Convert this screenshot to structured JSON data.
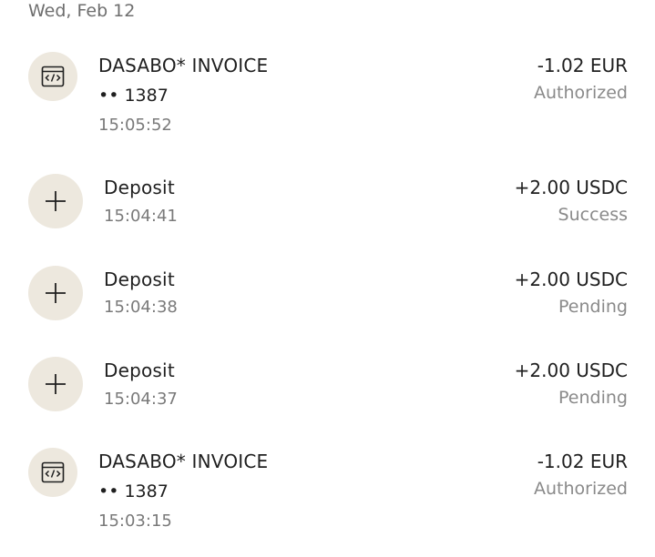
{
  "date_header": "Wed, Feb 12",
  "transactions": [
    {
      "icon": "card-code-icon",
      "title": "DASABO* INVOICE",
      "card": "•• 1387",
      "time": "15:05:52",
      "amount": "-1.02 EUR",
      "status": "Authorized"
    },
    {
      "icon": "plus-icon",
      "title": "Deposit",
      "time": "15:04:41",
      "amount": "+2.00 USDC",
      "status": "Success"
    },
    {
      "icon": "plus-icon",
      "title": "Deposit",
      "time": "15:04:38",
      "amount": "+2.00 USDC",
      "status": "Pending"
    },
    {
      "icon": "plus-icon",
      "title": "Deposit",
      "time": "15:04:37",
      "amount": "+2.00 USDC",
      "status": "Pending"
    },
    {
      "icon": "card-code-icon",
      "title": "DASABO* INVOICE",
      "card": "•• 1387",
      "time": "15:03:15",
      "amount": "-1.02 EUR",
      "status": "Authorized"
    }
  ],
  "colors": {
    "icon_background": "#ede8de",
    "primary_text": "#1f1f1f",
    "secondary_text": "#8a8a8a"
  }
}
